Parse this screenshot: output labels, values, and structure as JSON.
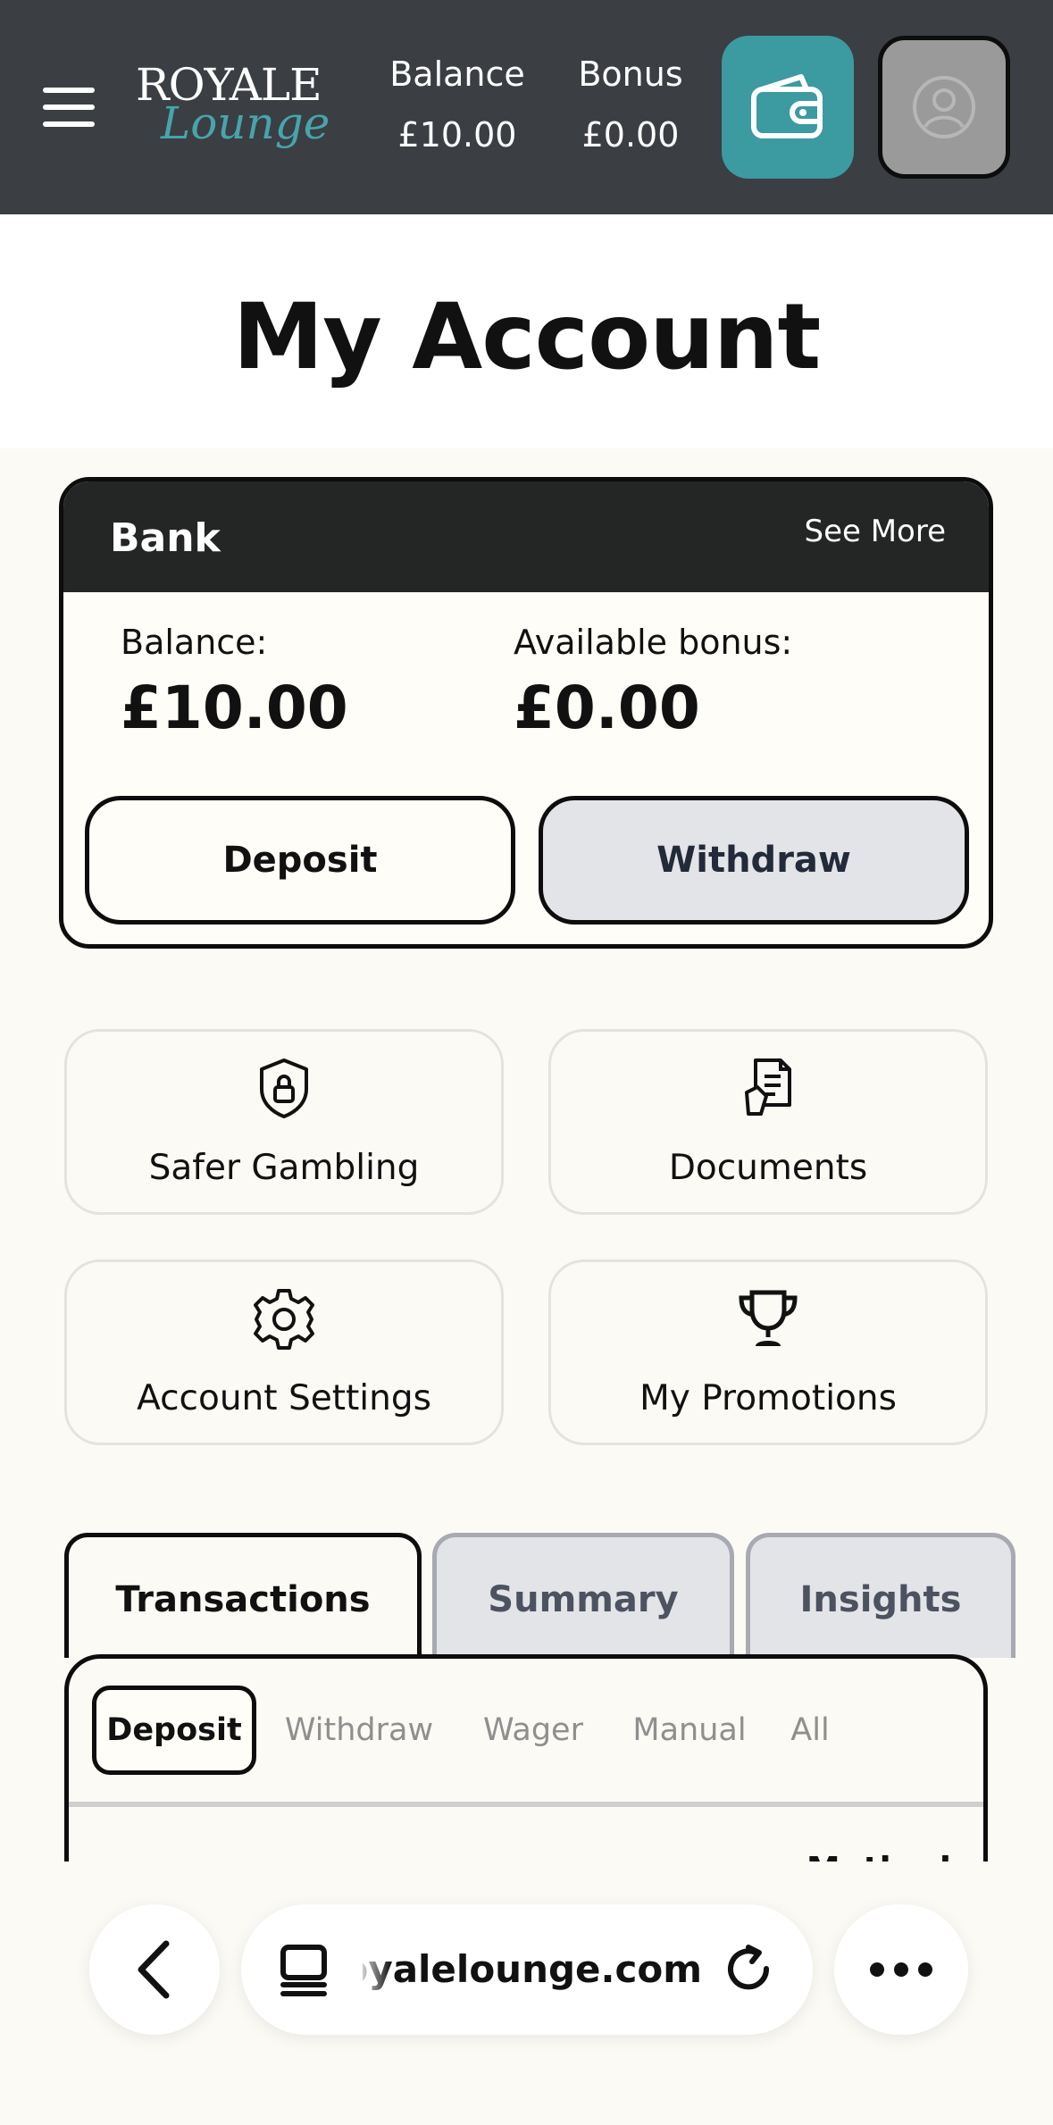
{
  "header": {
    "logo_top": "ROYALE",
    "logo_bottom": "Lounge",
    "balance_label": "Balance",
    "balance_value": "£10.00",
    "bonus_label": "Bonus",
    "bonus_value": "£0.00",
    "colors": {
      "bar": "#3b3e43",
      "wallet": "#3c9aa1",
      "logo_accent": "#46a5ab"
    }
  },
  "page": {
    "title": "My Account"
  },
  "bank": {
    "title": "Bank",
    "see_more": "See More",
    "balance_label": "Balance:",
    "balance_value": "£10.00",
    "bonus_label": "Available bonus:",
    "bonus_value": "£0.00",
    "deposit_label": "Deposit",
    "withdraw_label": "Withdraw"
  },
  "tiles": [
    {
      "label": "Safer Gambling",
      "icon": "shield-lock-icon"
    },
    {
      "label": "Documents",
      "icon": "document-icon"
    },
    {
      "label": "Account Settings",
      "icon": "gear-icon"
    },
    {
      "label": "My Promotions",
      "icon": "trophy-icon"
    }
  ],
  "tabs": [
    {
      "label": "Transactions",
      "active": true
    },
    {
      "label": "Summary",
      "active": false
    },
    {
      "label": "Insights",
      "active": false
    }
  ],
  "filters": [
    {
      "label": "Deposit",
      "active": true
    },
    {
      "label": "Withdraw",
      "active": false
    },
    {
      "label": "Wager",
      "active": false
    },
    {
      "label": "Manual",
      "active": false
    },
    {
      "label": "All",
      "active": false
    }
  ],
  "table": {
    "method_header": "Method"
  },
  "browser": {
    "url": "royalelounge.com"
  }
}
